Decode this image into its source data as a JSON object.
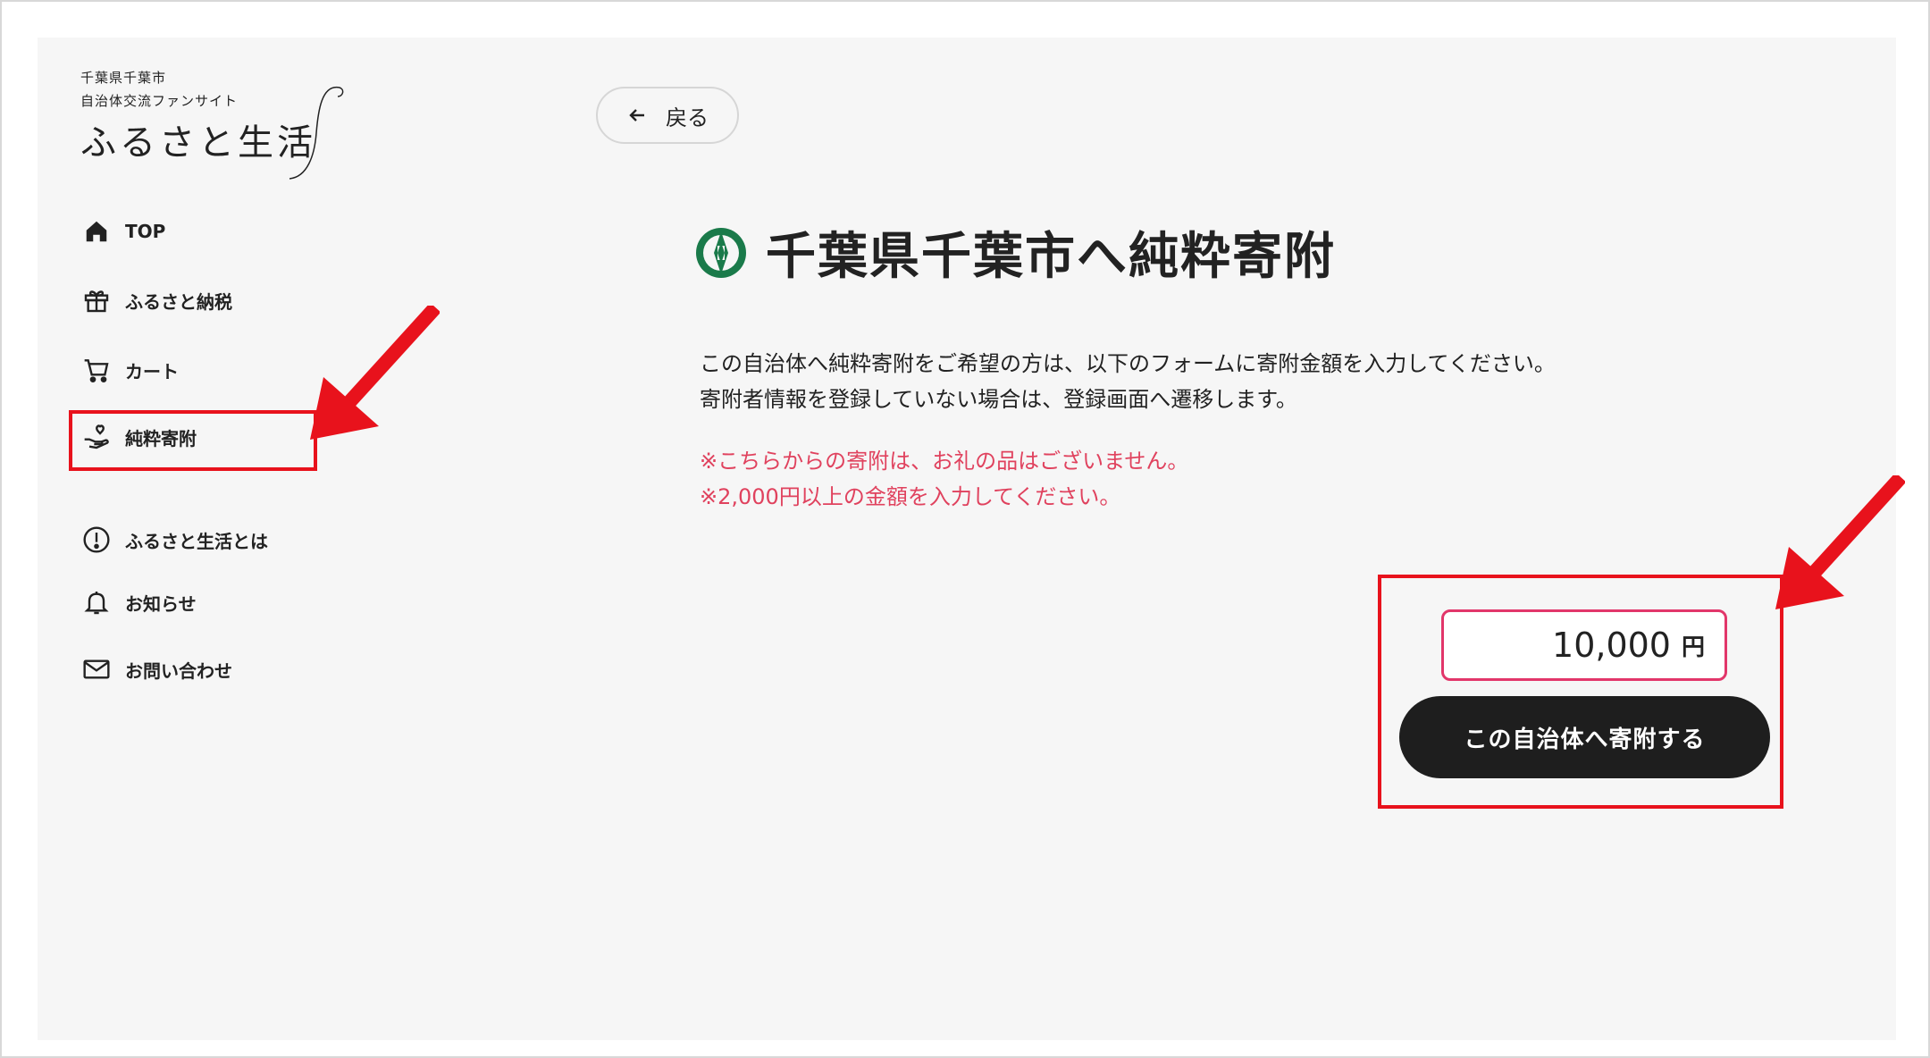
{
  "logo": {
    "line1": "千葉県千葉市",
    "line2": "自治体交流ファンサイト",
    "main": "ふるさと生活"
  },
  "nav": {
    "items": [
      {
        "label": "TOP",
        "icon": "home-icon"
      },
      {
        "label": "ふるさと納税",
        "icon": "gift-icon"
      },
      {
        "label": "カート",
        "icon": "cart-icon"
      },
      {
        "label": "純粋寄附",
        "icon": "donate-hand-icon"
      },
      {
        "label": "ふるさと生活とは",
        "icon": "info-icon"
      },
      {
        "label": "お知らせ",
        "icon": "bell-icon"
      },
      {
        "label": "お問い合わせ",
        "icon": "mail-icon"
      }
    ]
  },
  "back": {
    "label": "戻る"
  },
  "title": "千葉県千葉市へ純粋寄附",
  "description": {
    "line1": "この自治体へ純粋寄附をご希望の方は、以下のフォームに寄附金額を入力してください。",
    "line2": "寄附者情報を登録していない場合は、登録画面へ遷移します。"
  },
  "notes": {
    "line1": "※こちらからの寄附は、お礼の品はございません。",
    "line2": "※2,000円以上の金額を入力してください。"
  },
  "form": {
    "amount": "10,000",
    "unit": "円",
    "submit_label": "この自治体へ寄附する"
  },
  "colors": {
    "highlight": "#e8121c",
    "note_text": "#e0425e",
    "input_border": "#e2366a",
    "button_bg": "#1e1e1e",
    "emblem": "#1a7a4a"
  }
}
